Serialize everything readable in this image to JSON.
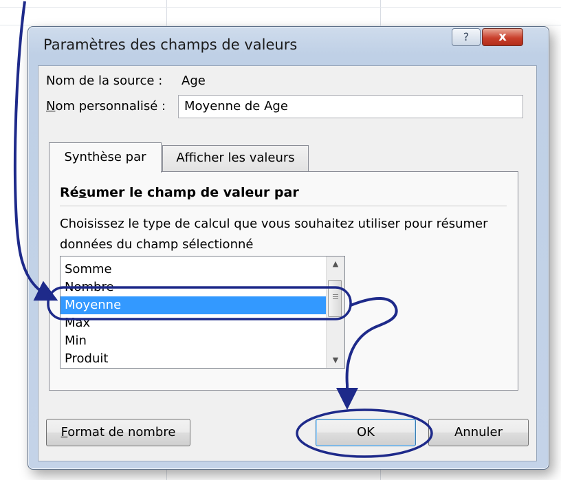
{
  "dialog": {
    "title": "Paramètres des champs de valeurs",
    "help_label": "?",
    "close_label": "x",
    "source_label": "Nom de la source :",
    "source_value": "Age",
    "custom_name_label": {
      "u": "N",
      "rest": "om personnalisé :"
    },
    "custom_name_value": "Moyenne de Age",
    "tabs": [
      {
        "label": "Synthèse par",
        "active": true
      },
      {
        "label": "Afficher les valeurs",
        "active": false
      }
    ],
    "section_heading": {
      "pre": "Ré",
      "u": "s",
      "post": "umer le champ de valeur par"
    },
    "description": "Choisissez le type de calcul que vous souhaitez utiliser pour résumer données du champ sélectionné",
    "list_items": [
      "Somme",
      "Nombre",
      "Moyenne",
      "Max",
      "Min",
      "Produit"
    ],
    "selected_item": "Moyenne",
    "buttons": {
      "format": {
        "u": "F",
        "rest": "ormat de nombre"
      },
      "ok": "OK",
      "cancel": "Annuler"
    }
  },
  "colors": {
    "annotation": "#1e2a8a",
    "selection": "#3399ff"
  }
}
